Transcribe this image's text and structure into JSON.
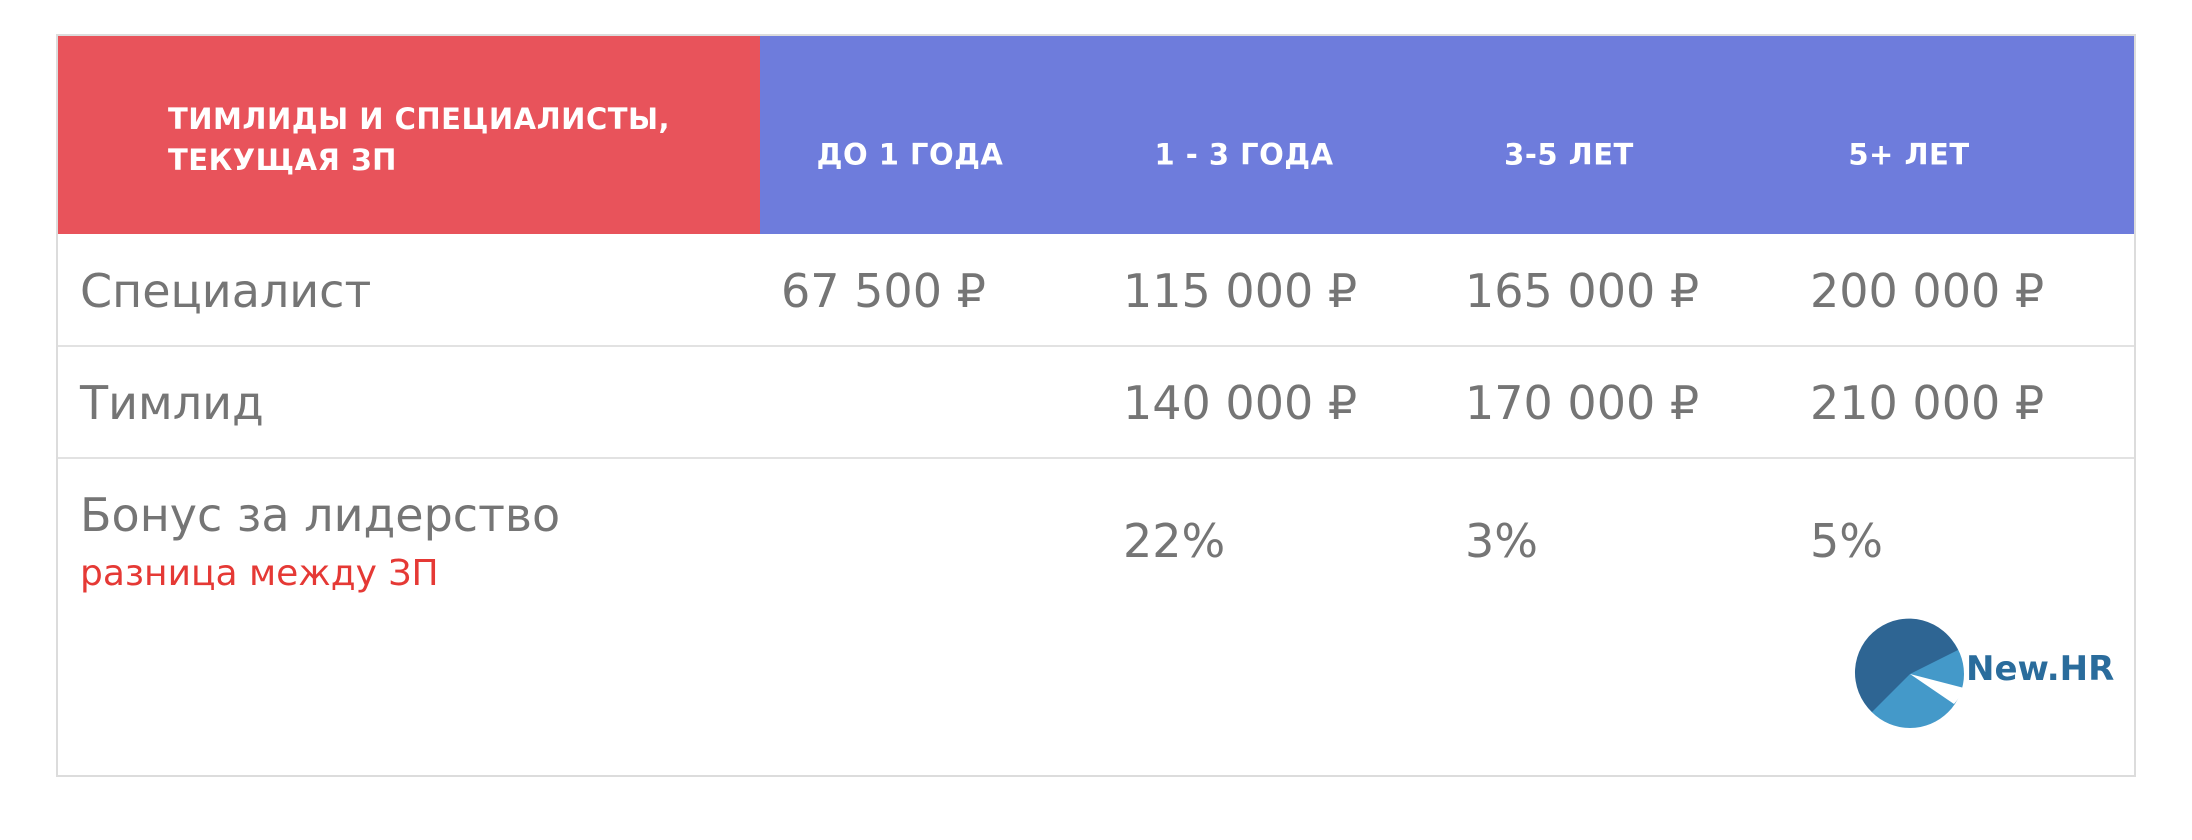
{
  "header": {
    "title_line1": "ТИМЛИДЫ И СПЕЦИАЛИСТЫ,",
    "title_line2": "ТЕКУЩАЯ ЗП",
    "columns": [
      "ДО 1 ГОДА",
      "1 - 3 ГОДА",
      "3-5 ЛЕТ",
      "5+ ЛЕТ"
    ]
  },
  "rows": [
    {
      "label": "Специалист",
      "values": [
        "67 500 ₽",
        "115 000 ₽",
        "165 000 ₽",
        "200 000 ₽"
      ]
    },
    {
      "label": "Тимлид",
      "values": [
        "",
        "140 000 ₽",
        "170 000 ₽",
        "210 000 ₽"
      ]
    },
    {
      "label": "Бонус за лидерство",
      "sublabel": "разница между ЗП",
      "values": [
        "",
        "22%",
        "3%",
        "5%"
      ]
    }
  ],
  "logo": {
    "text": "New.HR"
  },
  "colors": {
    "header_accent": "#e8535b",
    "header_main": "#6e7cdc",
    "cell_text": "#757575",
    "sublabel": "#e53935",
    "logo_dark": "#2e6593",
    "logo_light": "#4499c9"
  }
}
